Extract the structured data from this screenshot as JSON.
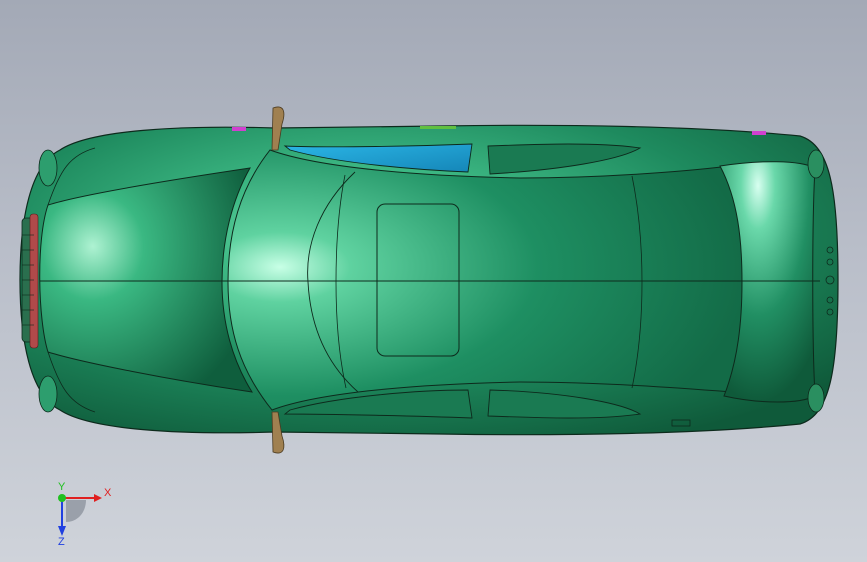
{
  "app": {
    "view": "Top"
  },
  "model": {
    "body_color": "#1e8a5e",
    "highlight_color": "#9ef0c8",
    "glass_color": "#1a9fd0",
    "edge_color": "#0d2a1c",
    "mirror_color": "#a08050"
  },
  "triad": {
    "x_label": "X",
    "y_label": "Y",
    "z_label": "Z",
    "x_color": "#e02020",
    "y_color": "#20c020",
    "z_color": "#2040e0"
  }
}
